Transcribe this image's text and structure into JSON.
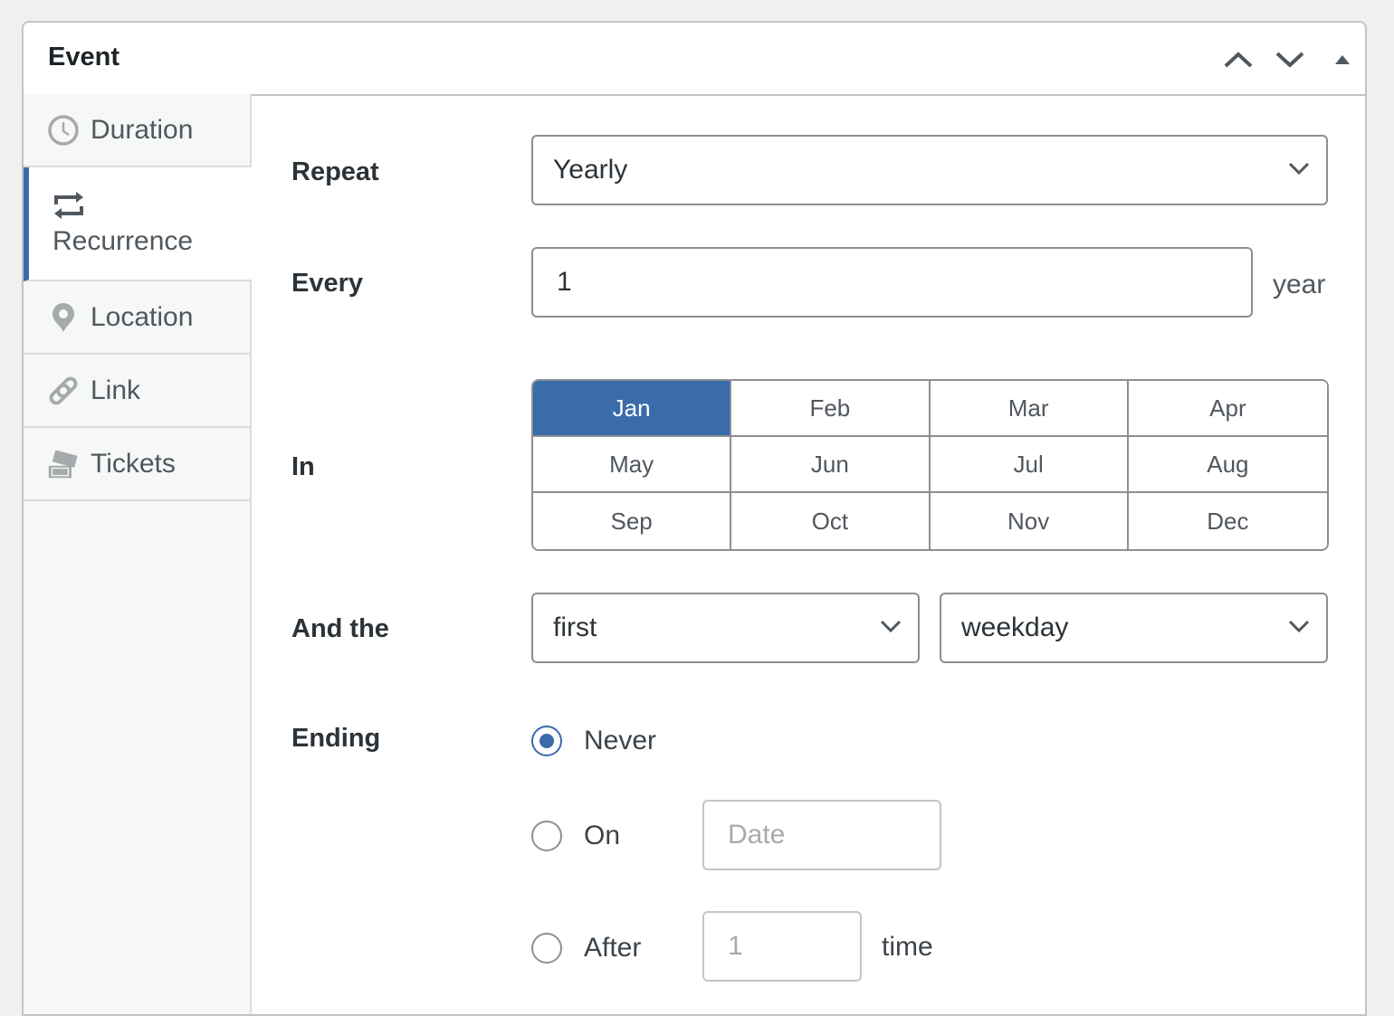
{
  "panel": {
    "title": "Event",
    "controls": [
      "move-up",
      "move-down",
      "collapse"
    ]
  },
  "sidebar": {
    "items": [
      {
        "label": "Duration",
        "icon": "clock-icon",
        "active": false
      },
      {
        "label": "Recurrence",
        "icon": "repeat-icon",
        "active": true
      },
      {
        "label": "Location",
        "icon": "map-pin-icon",
        "active": false
      },
      {
        "label": "Link",
        "icon": "link-icon",
        "active": false
      },
      {
        "label": "Tickets",
        "icon": "tickets-icon",
        "active": false
      }
    ]
  },
  "form": {
    "repeat": {
      "label": "Repeat",
      "value": "Yearly"
    },
    "every": {
      "label": "Every",
      "value": "1",
      "suffix": "year"
    },
    "in": {
      "label": "In",
      "months": [
        "Jan",
        "Feb",
        "Mar",
        "Apr",
        "May",
        "Jun",
        "Jul",
        "Aug",
        "Sep",
        "Oct",
        "Nov",
        "Dec"
      ],
      "selected": [
        "Jan"
      ]
    },
    "and_the": {
      "label": "And the",
      "ordinal": "first",
      "day": "weekday"
    },
    "ending": {
      "label": "Ending",
      "selected": "never",
      "options": {
        "never": {
          "label": "Never"
        },
        "on": {
          "label": "On",
          "placeholder": "Date"
        },
        "after": {
          "label": "After",
          "value": "1",
          "suffix": "time"
        }
      }
    }
  },
  "colors": {
    "accent": "#3a6bab",
    "border": "#8c8f94",
    "text": "#2c3338"
  }
}
